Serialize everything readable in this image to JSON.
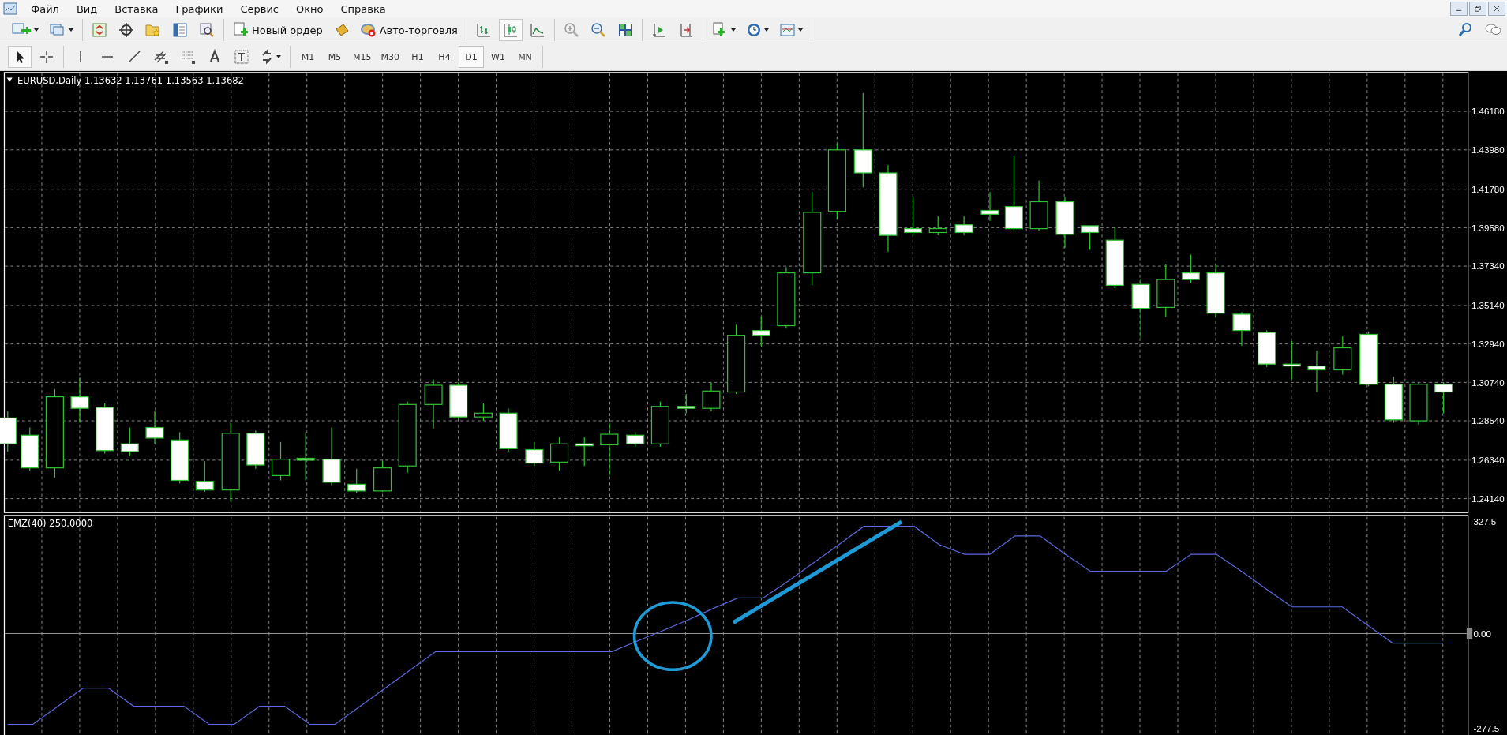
{
  "menu": [
    "Файл",
    "Вид",
    "Вставка",
    "Графики",
    "Сервис",
    "Окно",
    "Справка"
  ],
  "toolbar": {
    "new_order": "Новый ордер",
    "autotrading": "Авто-торговля"
  },
  "timeframes": [
    {
      "label": "M1",
      "selected": false
    },
    {
      "label": "M5",
      "selected": false
    },
    {
      "label": "M15",
      "selected": false
    },
    {
      "label": "M30",
      "selected": false
    },
    {
      "label": "H1",
      "selected": false
    },
    {
      "label": "H4",
      "selected": false
    },
    {
      "label": "D1",
      "selected": true
    },
    {
      "label": "W1",
      "selected": false
    },
    {
      "label": "MN",
      "selected": false
    }
  ],
  "chart": {
    "title": "EURUSD,Daily 1.13632 1.13761 1.13563 1.13682",
    "price_axis": [
      "1.46180",
      "1.43980",
      "1.41780",
      "1.39580",
      "1.37340",
      "1.35140",
      "1.32940",
      "1.30740",
      "1.28540",
      "1.26340",
      "1.24140"
    ]
  },
  "indicator": {
    "title": "EMZ(40) 250.0000",
    "chart_data": {
      "type": "line",
      "ylim": [
        -301.4,
        345.8
      ],
      "yticks": [
        {
          "value": 327.5,
          "label": "327.5"
        },
        {
          "value": 0,
          "label": "0.00"
        },
        {
          "value": -277.5,
          "label": "-277.5"
        }
      ],
      "series": [
        {
          "color": "#5a6ae0",
          "values": [
            -266,
            -266,
            -213,
            -160,
            -160,
            -213,
            -213,
            -213,
            -266,
            -266,
            -213,
            -213,
            -266,
            -266,
            -213,
            -160,
            -106,
            -53,
            -53,
            -53,
            -53,
            -53,
            -53,
            -53,
            -53,
            -22,
            8,
            39,
            73,
            104,
            104,
            154,
            207,
            260,
            314,
            314,
            314,
            260,
            232,
            232,
            286,
            286,
            232,
            182,
            182,
            182,
            182,
            232,
            232,
            182,
            129,
            78,
            78,
            78,
            25,
            -28,
            -28,
            -28
          ]
        }
      ]
    }
  }
}
